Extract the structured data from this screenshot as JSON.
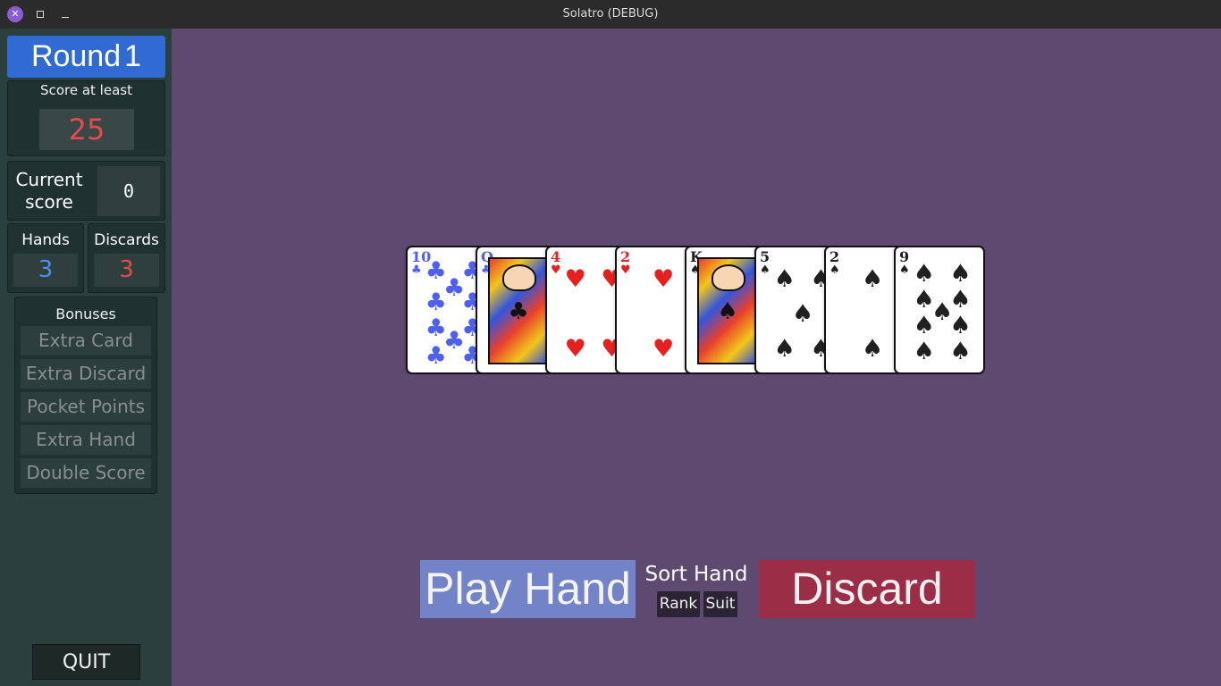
{
  "window": {
    "title": "Solatro (DEBUG)",
    "close_glyph": "✕"
  },
  "sidebar": {
    "round_label": "Round",
    "round_number": "1",
    "score_goal_label": "Score at least",
    "score_goal_value": "25",
    "current_score_label_line1": "Current",
    "current_score_label_line2": "score",
    "current_score_value": "0",
    "hands_label": "Hands",
    "hands_value": "3",
    "discards_label": "Discards",
    "discards_value": "3",
    "bonuses_label": "Bonuses",
    "bonuses": [
      "Extra Card",
      "Extra Discard",
      "Pocket Points",
      "Extra Hand",
      "Double Score"
    ],
    "quit_label": "QUIT"
  },
  "hand": {
    "cards": [
      {
        "rank": "10",
        "suit": "♣",
        "color": "clubs",
        "suit_name": "clubs"
      },
      {
        "rank": "Q",
        "suit": "♣",
        "color": "clubs",
        "suit_name": "clubs",
        "face": true
      },
      {
        "rank": "4",
        "suit": "♥",
        "color": "red",
        "suit_name": "hearts"
      },
      {
        "rank": "2",
        "suit": "♥",
        "color": "red",
        "suit_name": "hearts"
      },
      {
        "rank": "K",
        "suit": "♠",
        "color": "black",
        "suit_name": "spades",
        "face": true
      },
      {
        "rank": "5",
        "suit": "♠",
        "color": "black",
        "suit_name": "spades"
      },
      {
        "rank": "2",
        "suit": "♠",
        "color": "black",
        "suit_name": "spades"
      },
      {
        "rank": "9",
        "suit": "♠",
        "color": "black",
        "suit_name": "spades"
      }
    ]
  },
  "actions": {
    "play_label": "Play Hand",
    "sort_label": "Sort Hand",
    "sort_rank_label": "Rank",
    "sort_suit_label": "Suit",
    "discard_label": "Discard"
  },
  "colors": {
    "play_button": "#7283c7",
    "discard_button": "#9b2d47",
    "round_banner": "#2f6bd2",
    "table_background": "#5e4a70"
  }
}
